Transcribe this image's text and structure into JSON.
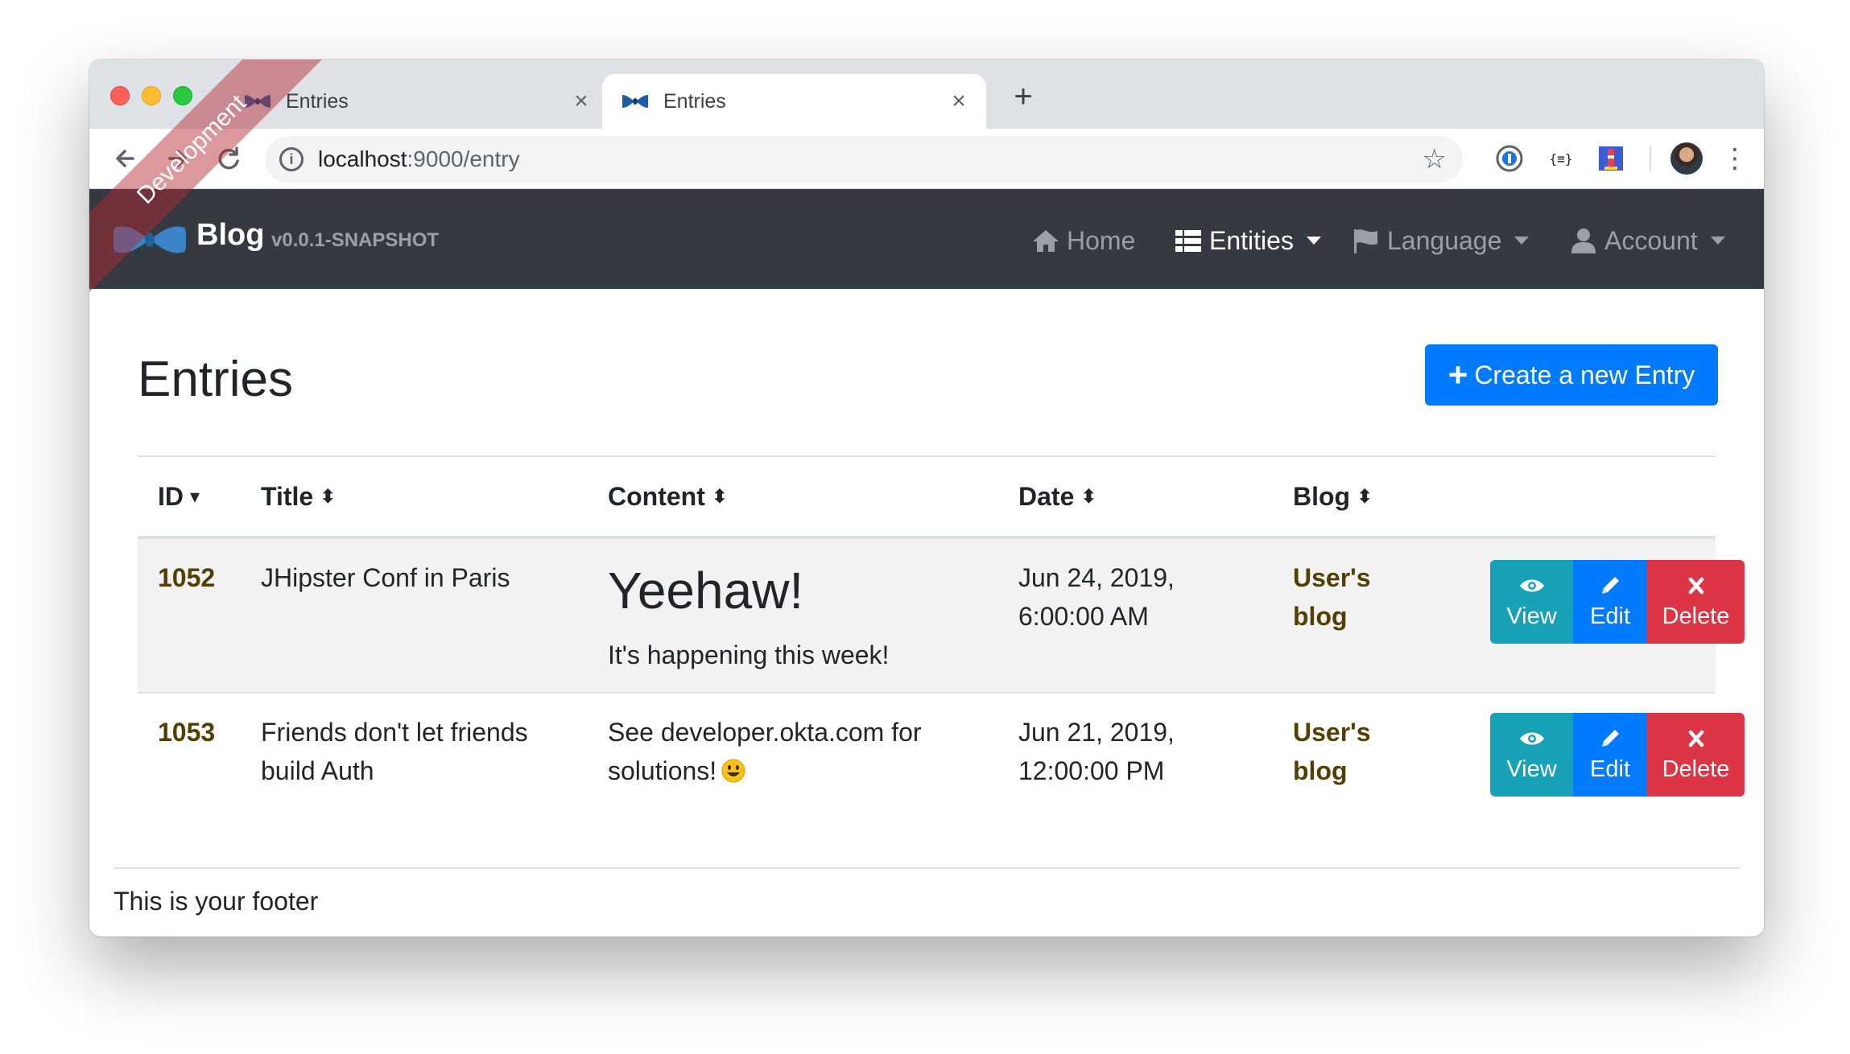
{
  "browser": {
    "tabs": [
      {
        "title": "Entries",
        "active": false
      },
      {
        "title": "Entries",
        "active": true
      }
    ],
    "url_host": "localhost",
    "url_rest": ":9000/entry",
    "info_icon": "i"
  },
  "navbar": {
    "brand": "Blog",
    "version": "v0.0.1-SNAPSHOT",
    "ribbon": "Development",
    "items": [
      {
        "label": "Home",
        "icon": "home-icon"
      },
      {
        "label": "Entities",
        "icon": "list-icon"
      },
      {
        "label": "Language",
        "icon": "flag-icon"
      },
      {
        "label": "Account",
        "icon": "user-icon"
      }
    ]
  },
  "page": {
    "title": "Entries",
    "create_button": "Create a new Entry",
    "create_plus": "+"
  },
  "table": {
    "headers": [
      "ID",
      "Title",
      "Content",
      "Date",
      "Blog"
    ],
    "id_sort": "▾",
    "other_sort": "⬍",
    "rows": [
      {
        "id": "1052",
        "title": "JHipster Conf in Paris",
        "content_heading": "Yeehaw!",
        "content": "It's happening this week!",
        "date_line1": "Jun 24, 2019,",
        "date_line2": "6:00:00 AM",
        "blog_line1": "User's",
        "blog_line2": "blog"
      },
      {
        "id": "1053",
        "title_line1": "Friends don't let friends",
        "title_line2": "build Auth",
        "content_line1": "See developer.okta.com for",
        "content_line2": "solutions!",
        "date_line1": "Jun 21, 2019,",
        "date_line2": "12:00:00 PM",
        "blog_line1": "User's",
        "blog_line2": "blog"
      }
    ],
    "actions": {
      "view": "View",
      "edit": "Edit",
      "delete": "Delete"
    }
  },
  "footer": {
    "text": "This is your footer"
  },
  "colors": {
    "navbar": "#343a40",
    "primary": "#007bff",
    "info": "#17a2b8",
    "danger": "#dc3545",
    "link": "#533f03"
  }
}
